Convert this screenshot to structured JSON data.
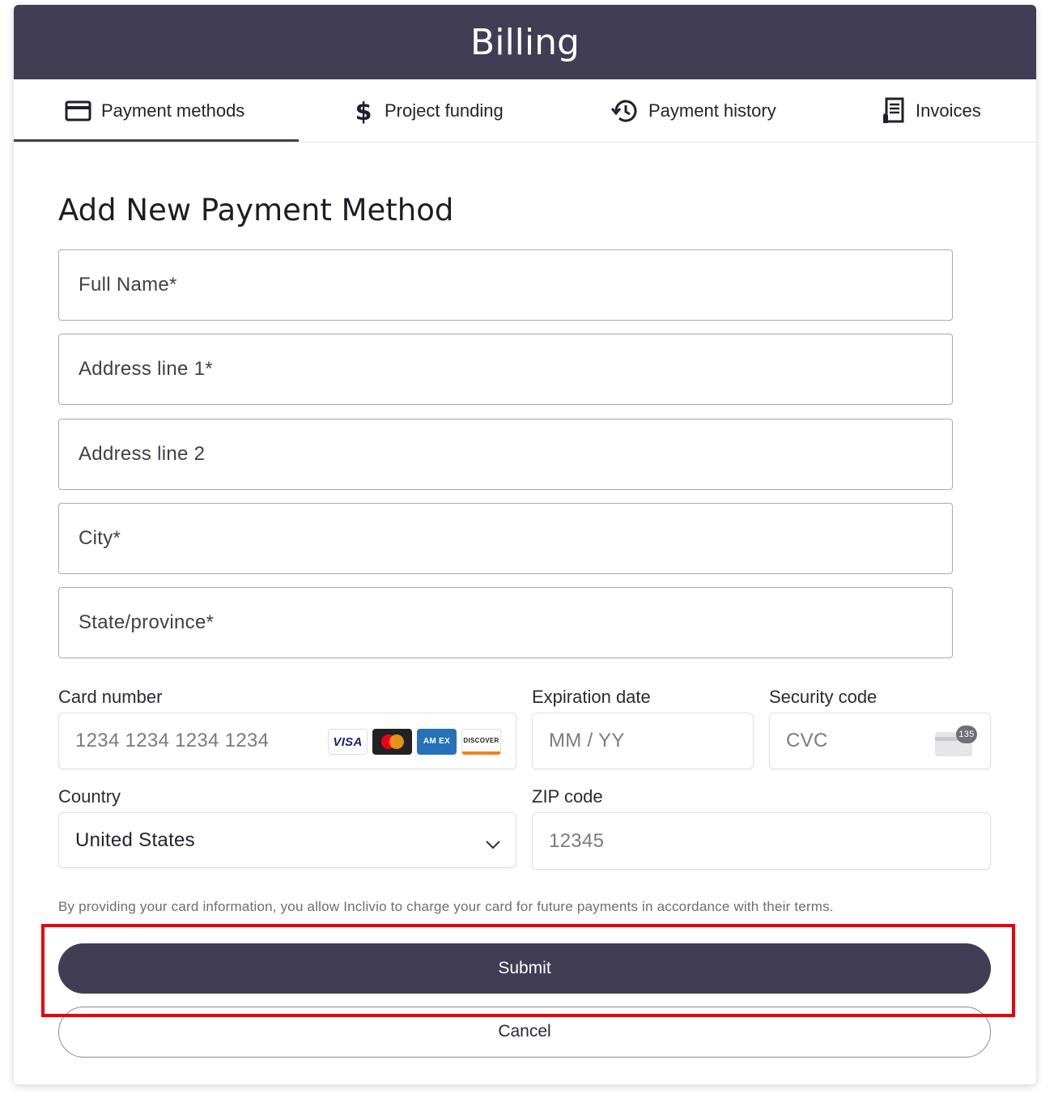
{
  "header": {
    "title": "Billing"
  },
  "tabs": [
    {
      "label": "Payment methods",
      "icon": "credit-card-icon",
      "active": true
    },
    {
      "label": "Project funding",
      "icon": "dollar-icon",
      "active": false
    },
    {
      "label": "Payment history",
      "icon": "history-icon",
      "active": false
    },
    {
      "label": "Invoices",
      "icon": "receipt-icon",
      "active": false
    }
  ],
  "form": {
    "title": "Add New Payment Method",
    "full_name": "Full Name*",
    "address1": "Address line 1*",
    "address2": "Address line 2",
    "city": "City*",
    "state": "State/province*"
  },
  "card": {
    "number_label": "Card number",
    "number_placeholder": "1234 1234 1234 1234",
    "brands": {
      "visa": "VISA",
      "amex": "AM EX",
      "discover": "DISCOVER"
    },
    "expiry_label": "Expiration date",
    "expiry_placeholder": "MM / YY",
    "cvc_label": "Security code",
    "cvc_placeholder": "CVC",
    "cvc_badge": "135"
  },
  "country": {
    "label": "Country",
    "value": "United States"
  },
  "zip": {
    "label": "ZIP code",
    "placeholder": "12345"
  },
  "disclaimer": "By providing your card information, you allow Inclivio to charge your card for future payments in accordance with their terms.",
  "actions": {
    "submit": "Submit",
    "cancel": "Cancel"
  },
  "colors": {
    "primary": "#403d55",
    "highlight": "#e8000b"
  }
}
